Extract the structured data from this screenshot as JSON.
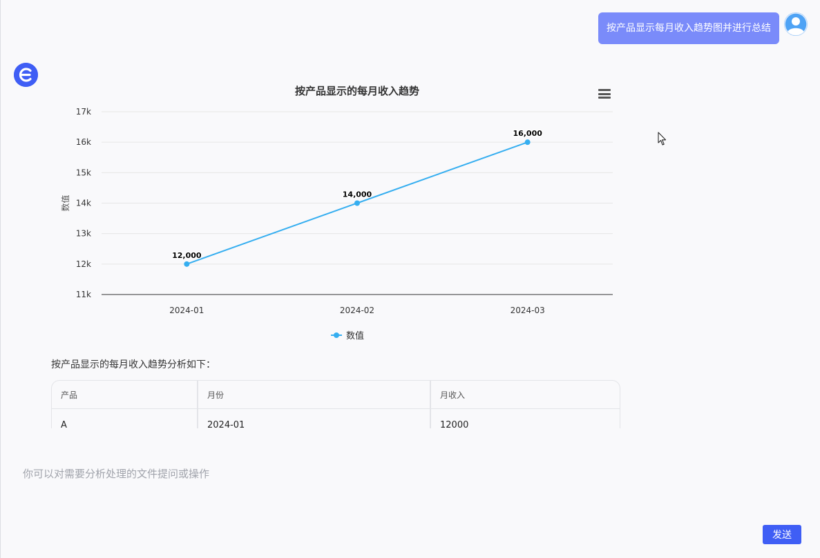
{
  "user_message": {
    "text": "按产品显示每月收入趋势图并进行总结"
  },
  "chart_data": {
    "type": "line",
    "title": "按产品显示的每月收入趋势",
    "xlabel": "",
    "ylabel": "数值",
    "categories": [
      "2024-01",
      "2024-02",
      "2024-03"
    ],
    "series": [
      {
        "name": "数值",
        "values": [
          12000,
          14000,
          16000
        ],
        "labels": [
          "12,000",
          "14,000",
          "16,000"
        ]
      }
    ],
    "ylim": [
      11000,
      17000
    ],
    "yticks": [
      11000,
      12000,
      13000,
      14000,
      15000,
      16000,
      17000
    ],
    "ytick_labels": [
      "11k",
      "12k",
      "13k",
      "14k",
      "15k",
      "16k",
      "17k"
    ],
    "grid": true,
    "legend_position": "bottom-center",
    "line_color": "#35aef0"
  },
  "analysis_text": "按产品显示的每月收入趋势分析如下：",
  "table": {
    "headers": [
      "产品",
      "月份",
      "月收入"
    ],
    "rows": [
      [
        "A",
        "2024-01",
        "12000"
      ]
    ]
  },
  "input": {
    "placeholder": "你可以对需要分析处理的文件提问或操作"
  },
  "send_button": {
    "label": "发送"
  },
  "colors": {
    "accent": "#3f5ef5",
    "user_bubble": "#7a8bfa",
    "background": "#f9f9fb"
  },
  "icons": {
    "avatar": "user-avatar-icon",
    "logo": "bot-logo-icon",
    "menu": "hamburger-menu-icon",
    "cursor": "mouse-cursor-icon"
  }
}
